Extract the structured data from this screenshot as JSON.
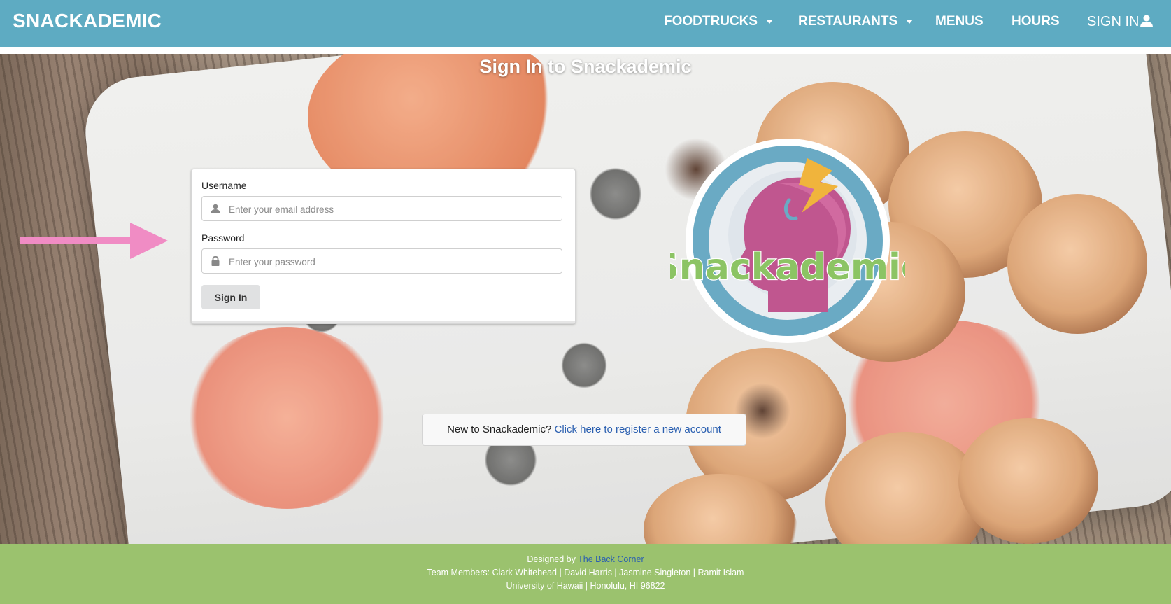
{
  "navbar": {
    "brand": "SNACKADEMIC",
    "items": [
      {
        "label": "FOODTRUCKS",
        "dropdown": true
      },
      {
        "label": "RESTAURANTS",
        "dropdown": true
      },
      {
        "label": "MENUS",
        "dropdown": false
      },
      {
        "label": "HOURS",
        "dropdown": false
      }
    ],
    "signin_label": "SIGN IN"
  },
  "page": {
    "title": "Sign In to Snackademic"
  },
  "form": {
    "username_label": "Username",
    "username_placeholder": "Enter your email address",
    "password_label": "Password",
    "password_placeholder": "Enter your password",
    "submit_label": "Sign In"
  },
  "logo": {
    "text": "Snackademic"
  },
  "register": {
    "prompt": "New to Snackademic?",
    "link": "Click here to register a new account"
  },
  "footer": {
    "designed_prefix": "Designed by",
    "designed_by": "The Back Corner",
    "team": "Team Members: Clark Whitehead | David Harris | Jasmine Singleton | Ramit Islam",
    "address": "University of Hawaii | Honolulu, HI 96822"
  },
  "colors": {
    "navbar": "#5eabc2",
    "footer": "#9bc26e",
    "link": "#2a5fb0",
    "arrow": "#f08cc4",
    "logo_head": "#c0568f",
    "logo_ring": "#6aaac4",
    "logo_text": "#8cc464",
    "logo_bolt": "#f0b43c"
  }
}
